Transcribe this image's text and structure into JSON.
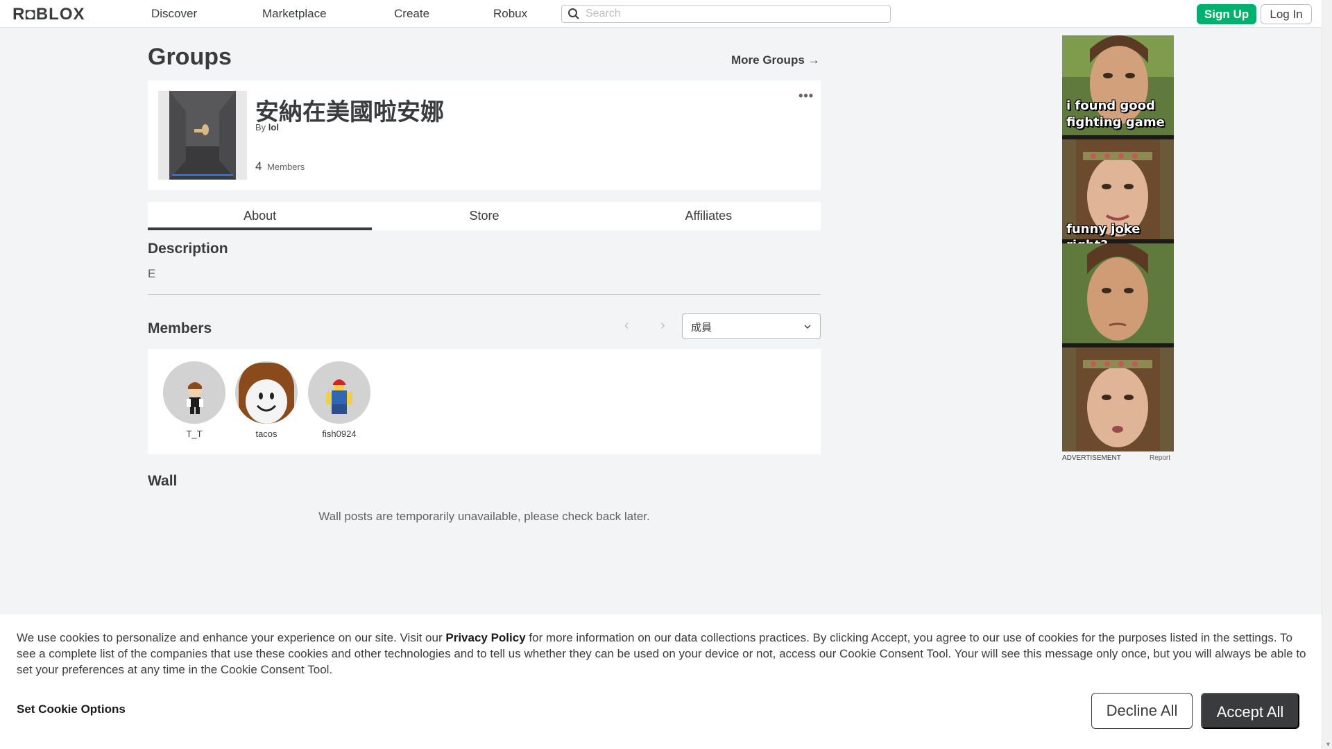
{
  "nav": {
    "logo": "R◘BLOX",
    "links": [
      "Discover",
      "Marketplace",
      "Create",
      "Robux"
    ],
    "search_placeholder": "Search",
    "signup_label": "Sign Up",
    "login_label": "Log In"
  },
  "page": {
    "title": "Groups",
    "more_groups": "More Groups →"
  },
  "group": {
    "name": "安納在美國啦安娜",
    "by_label": "By",
    "owner": "lol",
    "member_count": "4",
    "members_label": "Members",
    "menu_icon": "more-dots-icon",
    "menu_glyph": "•••"
  },
  "tabs": [
    {
      "label": "About",
      "active": true
    },
    {
      "label": "Store",
      "active": false
    },
    {
      "label": "Affiliates",
      "active": false
    }
  ],
  "description": {
    "title": "Description",
    "text": "E"
  },
  "members": {
    "title": "Members",
    "prev_glyph": "‹",
    "next_glyph": "›",
    "role_selected": "成員",
    "list": [
      {
        "name": "T_T",
        "avatar_icon": "avatar-tt"
      },
      {
        "name": "tacos",
        "avatar_icon": "avatar-tacos"
      },
      {
        "name": "fish0924",
        "avatar_icon": "avatar-fish"
      }
    ]
  },
  "wall": {
    "title": "Wall",
    "message": "Wall posts are temporarily unavailable, please check back later."
  },
  "ad": {
    "captions": [
      "i found good",
      "fighting game",
      "funny joke right?"
    ],
    "label": "ADVERTISEMENT",
    "report": "Report"
  },
  "cookie": {
    "text_before": "We use cookies to personalize and enhance your experience on our site. Visit our ",
    "policy_link": "Privacy Policy",
    "text_after": " for more information on our data collections practices. By clicking Accept, you agree to our use of cookies for the purposes listed in the settings. To see a complete list of the companies that use these cookies and other technologies and to tell us whether they can be used on your device or not, access our Cookie Consent Tool. Your will see this message only once, but you will always be able to set your preferences at any time in the Cookie Consent Tool.",
    "options_label": "Set Cookie Options",
    "decline_label": "Decline All",
    "accept_label": "Accept All"
  },
  "colors": {
    "accent_green": "#00b06f",
    "text_primary": "#393b3d",
    "page_bg": "#f2f4f5"
  }
}
